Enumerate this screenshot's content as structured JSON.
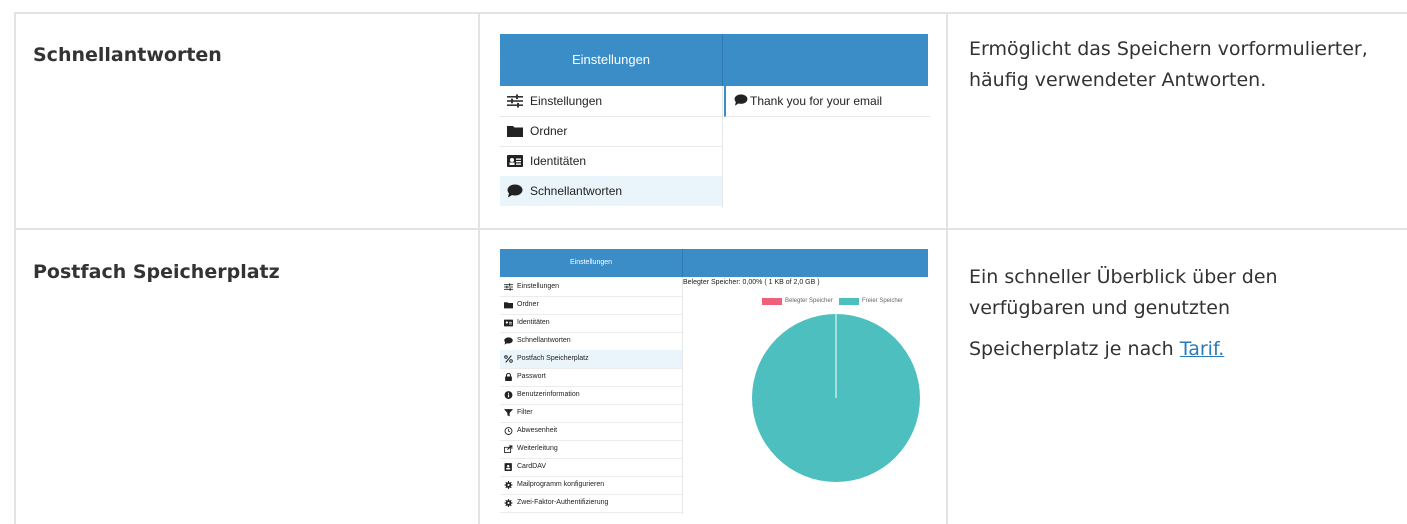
{
  "rows": [
    {
      "feature": "Schnellantworten",
      "description": "Ermöglicht das Speichern vorformulierter, häufig verwendeter Antworten.",
      "screenshot": {
        "header_title": "Einstellungen",
        "menu": [
          {
            "label": "Einstellungen",
            "icon": "sliders-icon"
          },
          {
            "label": "Ordner",
            "icon": "folder-icon"
          },
          {
            "label": "Identitäten",
            "icon": "id-card-icon"
          },
          {
            "label": "Schnellantworten",
            "icon": "comment-icon",
            "active": true
          }
        ],
        "responses": [
          "Thank you for your email"
        ]
      }
    },
    {
      "feature": "Postfach Speicherplatz",
      "description_lines": [
        "Ein schneller Überblick über den",
        "verfügbaren und genutzten"
      ],
      "description_prefix": "Speicherplatz je nach ",
      "description_link": "Tarif.",
      "screenshot": {
        "header_title": "Einstellungen",
        "menu": [
          {
            "label": "Einstellungen",
            "icon": "sliders-icon"
          },
          {
            "label": "Ordner",
            "icon": "folder-icon"
          },
          {
            "label": "Identitäten",
            "icon": "id-card-icon"
          },
          {
            "label": "Schnellantworten",
            "icon": "comment-icon"
          },
          {
            "label": "Postfach Speicherplatz",
            "icon": "percent-icon",
            "active": true
          },
          {
            "label": "Passwort",
            "icon": "lock-icon"
          },
          {
            "label": "Benutzerinformation",
            "icon": "info-icon"
          },
          {
            "label": "Filter",
            "icon": "filter-icon"
          },
          {
            "label": "Abwesenheit",
            "icon": "clock-icon"
          },
          {
            "label": "Weiterleitung",
            "icon": "share-icon"
          },
          {
            "label": "CardDAV",
            "icon": "contact-card-icon"
          },
          {
            "label": "Mailprogramm konfigurieren",
            "icon": "cog-icon"
          },
          {
            "label": "Zwei-Faktor-Authentifizierung",
            "icon": "cog-icon"
          }
        ],
        "usage_text": "Belegter Speicher: 0,00% ( 1 KB of 2,0 GB )",
        "legend": [
          {
            "label": "Belegter Speicher",
            "color": "#f0607a"
          },
          {
            "label": "Freier Speicher",
            "color": "#4dbfbf"
          }
        ],
        "chart_data": {
          "type": "pie",
          "categories": [
            "Belegter Speicher",
            "Freier Speicher"
          ],
          "values": [
            0.0,
            100.0
          ],
          "colors": [
            "#f0607a",
            "#4dbfbf"
          ]
        }
      }
    }
  ],
  "colors": {
    "accent": "#3a8dc7",
    "link": "#2a7ab9"
  }
}
